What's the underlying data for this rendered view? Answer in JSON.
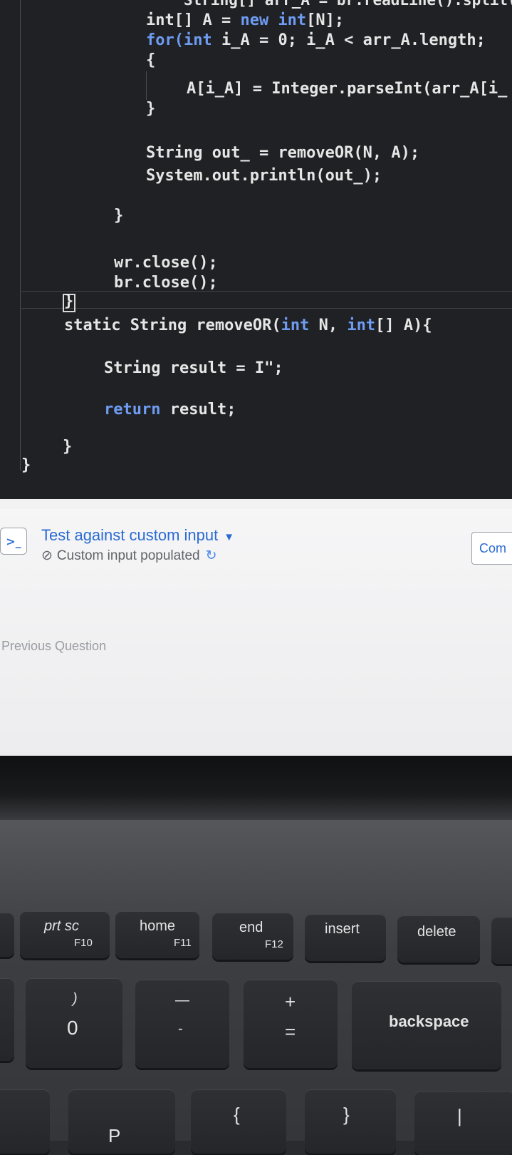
{
  "editor": {
    "lines": {
      "l0": "String[] arr_A = br.readLine().split(",
      "l1a": "int[] A = ",
      "l1b": "new int",
      "l1c": "[N];",
      "l2a": "for",
      "l2b": "(int",
      "l2c": " i_A = 0; i_A < arr_A.length;",
      "l3": "{",
      "l4": "A[i_A] = Integer.parseInt(arr_A[i_",
      "l5": "}",
      "l6": "String out_ = removeOR(N, A);",
      "l7": "System.out.println(out_);",
      "l8": "}",
      "l9": "wr.close();",
      "l10": "br.close();",
      "l11": "}",
      "l12a": "static String removeOR(",
      "l12b": "int",
      "l12c": " N, ",
      "l12d": "int",
      "l12e": "[] A){",
      "l13a": "String result = ",
      "l13b": "\";",
      "l14a": "return",
      "l14b": " result;",
      "l15": "}",
      "l16": "}"
    }
  },
  "panel": {
    "custom_input_title": "Test against custom input",
    "custom_input_status": "Custom input populated",
    "compile_label": "Com",
    "previous_question": "Previous Question"
  },
  "keyboard": {
    "prtsc": {
      "main": "prt sc",
      "sub": "F10"
    },
    "home": {
      "main": "home",
      "sub": "F11"
    },
    "end": {
      "main": "end",
      "sub": "F12"
    },
    "insert": {
      "main": "insert"
    },
    "delete": {
      "main": "delete"
    },
    "zero": {
      "top": ")",
      "main": "0"
    },
    "minus": {
      "top": "—",
      "main": "-"
    },
    "equals": {
      "top": "+",
      "main": "="
    },
    "backspace": {
      "main": "backspace"
    },
    "p": {
      "main": "P"
    },
    "lbrace": {
      "main": "{"
    },
    "rbrace": {
      "main": "}"
    },
    "pipe": {
      "main": "|"
    }
  },
  "colors": {
    "editor_bg": "#1f2124",
    "keyword": "#6f9cf2",
    "link_blue": "#2a6bd2"
  }
}
